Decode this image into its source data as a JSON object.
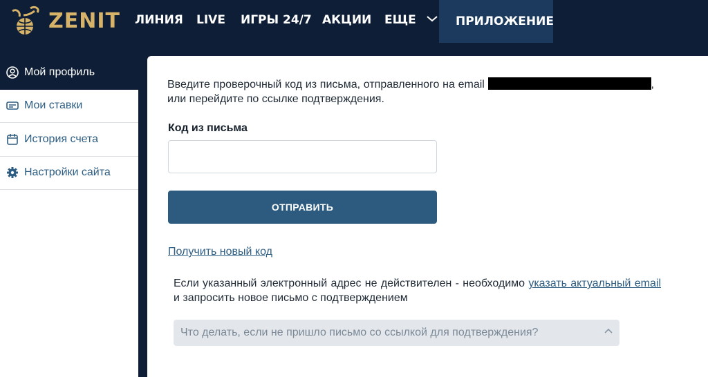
{
  "header": {
    "brand": "ZENIT",
    "nav": [
      "ЛИНИЯ",
      "LIVE",
      "ИГРЫ 24/7",
      "АКЦИИ",
      "ЕЩЕ"
    ],
    "app_label": "ПРИЛОЖЕНИЕ"
  },
  "sidebar": {
    "items": [
      {
        "label": "Мой профиль",
        "icon": "user-circle-icon",
        "active": true
      },
      {
        "label": "Мои ставки",
        "icon": "ticket-icon"
      },
      {
        "label": "История счета",
        "icon": "calendar-icon"
      },
      {
        "label": "Настройки сайта",
        "icon": "gear-icon"
      }
    ]
  },
  "main": {
    "intro_before": "Введите проверочный код из письма, отправленного на email",
    "intro_after": ", или перейдите по ссылке подтверждения.",
    "code_label": "Код из письма",
    "code_value": "",
    "submit_label": "ОТПРАВИТЬ",
    "new_code_link": "Получить новый код",
    "info_before": "Если указанный электронный адрес не действителен - необходимо ",
    "info_link": "указать актуальный email",
    "info_after": " и запросить новое письмо с подтверждением",
    "faq_question": "Что делать, если не пришло письмо со ссылкой для подтверждения?"
  },
  "colors": {
    "navy": "#0d1e36",
    "accent_gold": "#d7b36a",
    "button_blue": "#2d5b80",
    "link_blue": "#2d5d82"
  }
}
